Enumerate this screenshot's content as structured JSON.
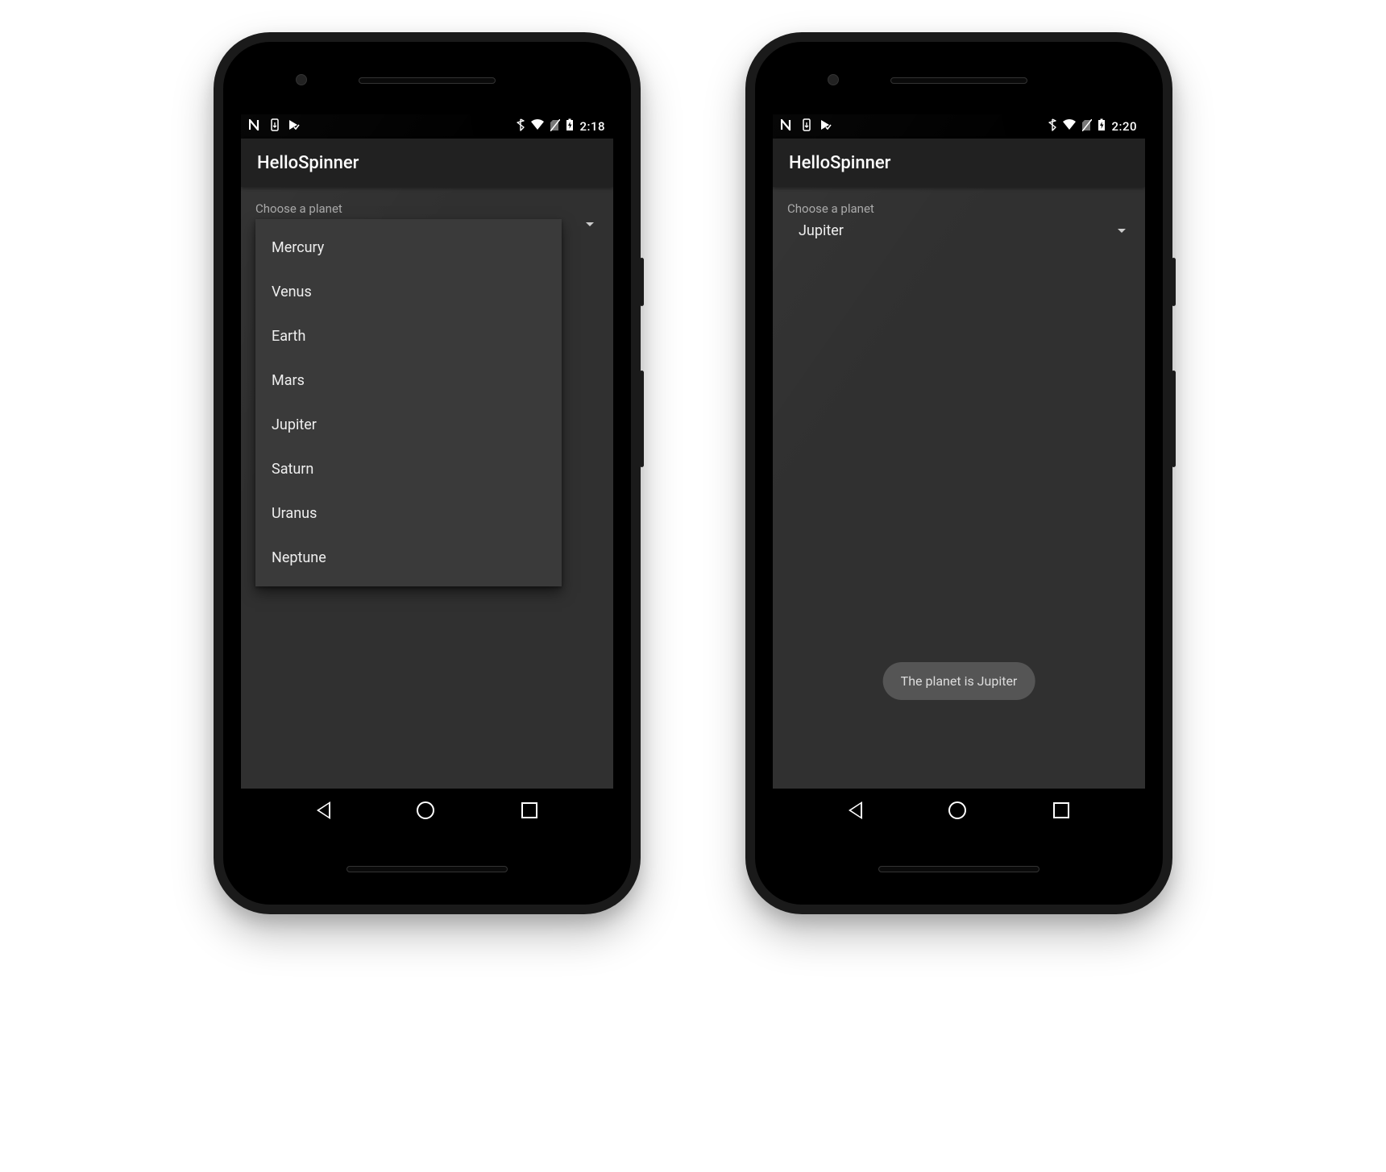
{
  "phones": {
    "left": {
      "status_time": "2:18",
      "app_title": "HelloSpinner",
      "label": "Choose a planet",
      "options": [
        "Mercury",
        "Venus",
        "Earth",
        "Mars",
        "Jupiter",
        "Saturn",
        "Uranus",
        "Neptune"
      ]
    },
    "right": {
      "status_time": "2:20",
      "app_title": "HelloSpinner",
      "label": "Choose a planet",
      "selected": "Jupiter",
      "toast": "The planet is Jupiter"
    }
  }
}
